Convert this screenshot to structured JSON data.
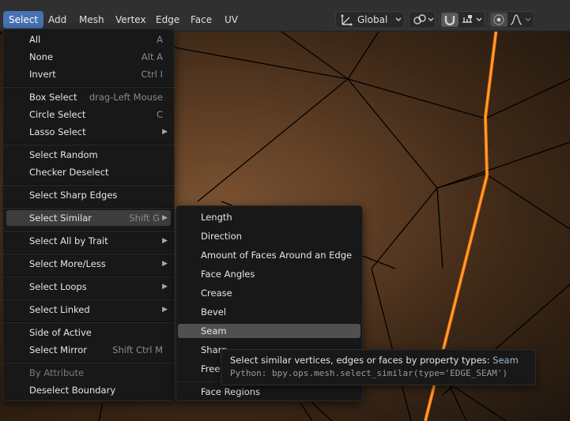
{
  "topbar": {
    "menus": [
      "Select",
      "Add",
      "Mesh",
      "Vertex",
      "Edge",
      "Face",
      "UV"
    ],
    "transform_orientation": "Global"
  },
  "select_menu": {
    "items": [
      {
        "label": "All",
        "shortcut": "A"
      },
      {
        "label": "None",
        "shortcut": "Alt A"
      },
      {
        "label": "Invert",
        "shortcut": "Ctrl I"
      },
      {
        "label": "Box Select",
        "shortcut": "drag-Left Mouse"
      },
      {
        "label": "Circle Select",
        "shortcut": "C"
      },
      {
        "label": "Lasso Select",
        "shortcut": ""
      },
      {
        "label": "Select Random",
        "shortcut": ""
      },
      {
        "label": "Checker Deselect",
        "shortcut": ""
      },
      {
        "label": "Select Sharp Edges",
        "shortcut": ""
      },
      {
        "label": "Select Similar",
        "shortcut": "Shift G"
      },
      {
        "label": "Select All by Trait",
        "shortcut": ""
      },
      {
        "label": "Select More/Less",
        "shortcut": ""
      },
      {
        "label": "Select Loops",
        "shortcut": ""
      },
      {
        "label": "Select Linked",
        "shortcut": ""
      },
      {
        "label": "Side of Active",
        "shortcut": ""
      },
      {
        "label": "Select Mirror",
        "shortcut": "Shift Ctrl M"
      },
      {
        "label": "By Attribute",
        "shortcut": ""
      },
      {
        "label": "Deselect Boundary",
        "shortcut": ""
      }
    ]
  },
  "similar_menu": {
    "items": [
      "Length",
      "Direction",
      "Amount of Faces Around an Edge",
      "Face Angles",
      "Crease",
      "Bevel",
      "Seam",
      "Sharp",
      "Freestyle",
      "Face Regions"
    ]
  },
  "tooltip": {
    "description": "Select similar vertices, edges or faces by property types:",
    "value": "Seam",
    "python": "Python: bpy.ops.mesh.select_similar(type='EDGE_SEAM')"
  },
  "icons": {
    "submenu_arrow": "triangle-right-icon",
    "orientation": "transform-orientation-icon",
    "pivot": "pivot-point-icon",
    "snap": "snap-magnet-icon",
    "snap_target": "snap-increment-icon",
    "proportional": "proportional-edit-icon",
    "falloff": "falloff-curve-icon"
  }
}
